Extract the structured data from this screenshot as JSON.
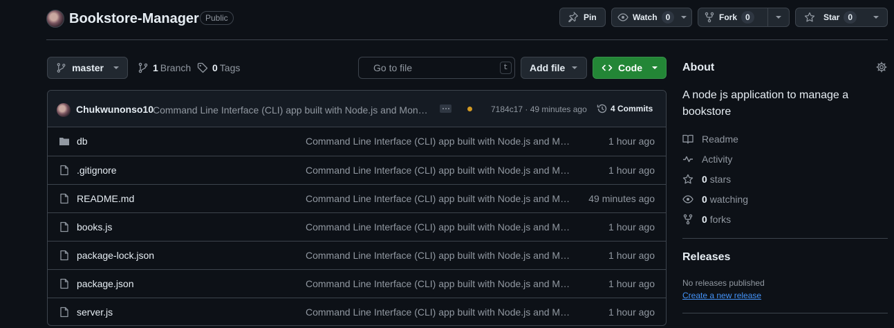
{
  "repo": {
    "name": "Bookstore-Manager",
    "visibility": "Public"
  },
  "header_actions": {
    "pin_label": "Pin",
    "watch_label": "Watch",
    "watch_count": "0",
    "fork_label": "Fork",
    "fork_count": "0",
    "star_label": "Star",
    "star_count": "0"
  },
  "toolbar": {
    "branch_selected": "master",
    "branches_count": "1",
    "branches_label": "Branch",
    "tags_count": "0",
    "tags_label": "Tags",
    "search_placeholder": "Go to file",
    "search_shortcut": "t",
    "add_file_label": "Add file",
    "code_label": "Code"
  },
  "latest_commit": {
    "author": "Chukwunonso10",
    "message": "Command Line Interface (CLI) app built with Node.js and Mong...",
    "hash_and_time": "7184c17 · 49 minutes ago",
    "commits_label": "4 Commits",
    "status_color": "#d29922"
  },
  "files": [
    {
      "name": "db",
      "type": "folder",
      "icon": "folder-icon",
      "message": "Command Line Interface (CLI) app built with Node.js and Mo...",
      "time": "1 hour ago"
    },
    {
      "name": ".gitignore",
      "type": "file",
      "icon": "file-icon",
      "message": "Command Line Interface (CLI) app built with Node.js and Mo...",
      "time": "1 hour ago"
    },
    {
      "name": "README.md",
      "type": "file",
      "icon": "file-icon",
      "message": "Command Line Interface (CLI) app built with Node.js and Mo...",
      "time": "49 minutes ago"
    },
    {
      "name": "books.js",
      "type": "file",
      "icon": "file-icon",
      "message": "Command Line Interface (CLI) app built with Node.js and Mo...",
      "time": "1 hour ago"
    },
    {
      "name": "package-lock.json",
      "type": "file",
      "icon": "file-icon",
      "message": "Command Line Interface (CLI) app built with Node.js and Mo...",
      "time": "1 hour ago"
    },
    {
      "name": "package.json",
      "type": "file",
      "icon": "file-icon",
      "message": "Command Line Interface (CLI) app built with Node.js and Mo...",
      "time": "1 hour ago"
    },
    {
      "name": "server.js",
      "type": "file",
      "icon": "file-icon",
      "message": "Command Line Interface (CLI) app built with Node.js and Mo...",
      "time": "1 hour ago"
    }
  ],
  "about": {
    "title": "About",
    "description": "A node js application to manage a bookstore",
    "readme_label": "Readme",
    "activity_label": "Activity",
    "stars_count": "0",
    "stars_label": "stars",
    "watching_count": "0",
    "watching_label": "watching",
    "forks_count": "0",
    "forks_label": "forks"
  },
  "releases": {
    "title": "Releases",
    "empty_text": "No releases published",
    "create_link": "Create a new release"
  },
  "colors": {
    "background": "#0d1117",
    "border": "#3d444d",
    "primary_button": "#238636",
    "link": "#4493f8",
    "muted_text": "#9198a1"
  }
}
